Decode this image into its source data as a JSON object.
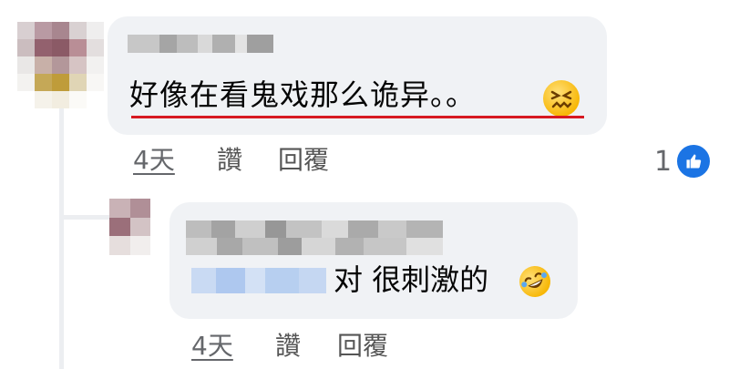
{
  "comment": {
    "text": "好像在看鬼戏那么诡异。。",
    "emoji": "confounded-face",
    "underline_color": "#d71921",
    "time": "4天",
    "like_label": "讚",
    "reply_label": "回覆",
    "reaction_count": "1",
    "reaction_icon": "like-icon"
  },
  "reply": {
    "text": "对 很刺激的",
    "emoji": "rolling-on-the-floor-laughing",
    "time": "4天",
    "like_label": "讚",
    "reply_label": "回覆"
  },
  "colors": {
    "bubble": "#f0f2f5",
    "text": "#050505",
    "meta_text": "#65676b",
    "like_blue": "#1b74e4",
    "mention_blur": "#b7cff0"
  }
}
